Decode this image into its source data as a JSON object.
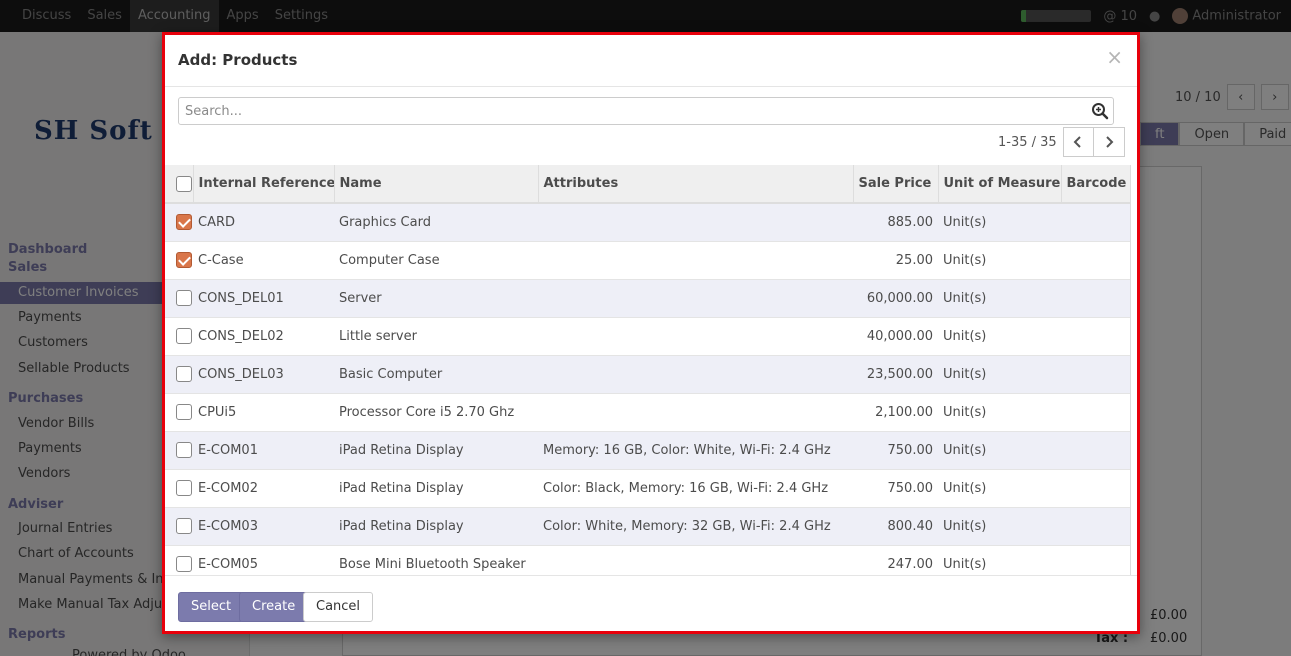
{
  "navbar": {
    "items": [
      "Discuss",
      "Sales",
      "Accounting",
      "Apps",
      "Settings"
    ],
    "active_index": 2,
    "progress_fraction": 0.06,
    "chat_count": "10",
    "user": "Administrator"
  },
  "background": {
    "logo_text": "SH Soft He",
    "pager": "10 / 10",
    "statuses": [
      "ft",
      "Open",
      "Paid"
    ],
    "sidebar": {
      "dashboard": "Dashboard",
      "sales": "Sales",
      "sales_items": [
        "Customer Invoices",
        "Payments",
        "Customers",
        "Sellable Products"
      ],
      "purchases": "Purchases",
      "purchases_items": [
        "Vendor Bills",
        "Payments",
        "Vendors"
      ],
      "adviser": "Adviser",
      "adviser_items": [
        "Journal Entries",
        "Chart of Accounts",
        "Manual Payments & Inv",
        "Make Manual Tax Adjus"
      ],
      "reports": "Reports",
      "powered": "Powered by Odoo"
    },
    "amounts": [
      "£0.00",
      "£0.00"
    ],
    "tax_label": "Tax :"
  },
  "dialog": {
    "title": "Add: Products",
    "close_glyph": "×",
    "search_placeholder": "Search...",
    "pager_value": "1-35 / 35",
    "columns": [
      "Internal Reference",
      "Name",
      "Attributes",
      "Sale Price",
      "Unit of Measure",
      "Barcode"
    ],
    "rows": [
      {
        "checked": true,
        "ref": "CARD",
        "name": "Graphics Card",
        "attributes": "",
        "price": "885.00",
        "uom": "Unit(s)",
        "barcode": ""
      },
      {
        "checked": true,
        "ref": "C-Case",
        "name": "Computer Case",
        "attributes": "",
        "price": "25.00",
        "uom": "Unit(s)",
        "barcode": ""
      },
      {
        "checked": false,
        "ref": "CONS_DEL01",
        "name": "Server",
        "attributes": "",
        "price": "60,000.00",
        "uom": "Unit(s)",
        "barcode": ""
      },
      {
        "checked": false,
        "ref": "CONS_DEL02",
        "name": "Little server",
        "attributes": "",
        "price": "40,000.00",
        "uom": "Unit(s)",
        "barcode": ""
      },
      {
        "checked": false,
        "ref": "CONS_DEL03",
        "name": "Basic Computer",
        "attributes": "",
        "price": "23,500.00",
        "uom": "Unit(s)",
        "barcode": ""
      },
      {
        "checked": false,
        "ref": "CPUi5",
        "name": "Processor Core i5 2.70 Ghz",
        "attributes": "",
        "price": "2,100.00",
        "uom": "Unit(s)",
        "barcode": ""
      },
      {
        "checked": false,
        "ref": "E-COM01",
        "name": "iPad Retina Display",
        "attributes": "Memory: 16 GB, Color: White, Wi-Fi: 2.4 GHz",
        "price": "750.00",
        "uom": "Unit(s)",
        "barcode": ""
      },
      {
        "checked": false,
        "ref": "E-COM02",
        "name": "iPad Retina Display",
        "attributes": "Color: Black, Memory: 16 GB, Wi-Fi: 2.4 GHz",
        "price": "750.00",
        "uom": "Unit(s)",
        "barcode": ""
      },
      {
        "checked": false,
        "ref": "E-COM03",
        "name": "iPad Retina Display",
        "attributes": "Color: White, Memory: 32 GB, Wi-Fi: 2.4 GHz",
        "price": "800.40",
        "uom": "Unit(s)",
        "barcode": ""
      },
      {
        "checked": false,
        "ref": "E-COM05",
        "name": "Bose Mini Bluetooth Speaker",
        "attributes": "",
        "price": "247.00",
        "uom": "Unit(s)",
        "barcode": ""
      }
    ],
    "buttons": {
      "select": "Select",
      "create": "Create",
      "cancel": "Cancel"
    }
  },
  "colors": {
    "primary": "#7c7bad",
    "highlight_border": "#e8000b",
    "checkbox_checked": "#d9764a"
  }
}
